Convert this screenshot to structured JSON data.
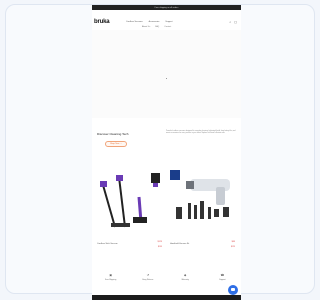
{
  "site": {
    "announcement": "Free shipping on all orders",
    "logo": "bruka",
    "nav_primary": [
      "Cordless Vacuums",
      "Accessories",
      "Support"
    ],
    "nav_secondary": [
      "About Us",
      "FAQ",
      "Contact"
    ],
    "header_icons": [
      "search-icon",
      "cart-icon"
    ]
  },
  "promo": {
    "title": "Discover Cleaning Tech",
    "button_label": "Shop Now →",
    "description": "Powerful cordless vacuums designed for everyday cleaning, lightweight build, long battery life, and smart accessories for every surface in your home. Explore our latest collection now."
  },
  "products": [
    {
      "name": "Cordless Stick Vacuum",
      "price": "$129",
      "price_old": "$199"
    },
    {
      "name": "Handheld Vacuum Kit",
      "price": "$89",
      "price_old": "$129"
    }
  ],
  "features": [
    {
      "icon": "truck-icon",
      "label": "Free Shipping"
    },
    {
      "icon": "return-icon",
      "label": "Easy Returns"
    },
    {
      "icon": "shield-icon",
      "label": "Warranty"
    },
    {
      "icon": "support-icon",
      "label": "Support"
    }
  ],
  "colors": {
    "accent": "#e8743c",
    "price": "#d83a3a",
    "product_purple": "#6a3bb5",
    "chat": "#2f6fe6"
  }
}
